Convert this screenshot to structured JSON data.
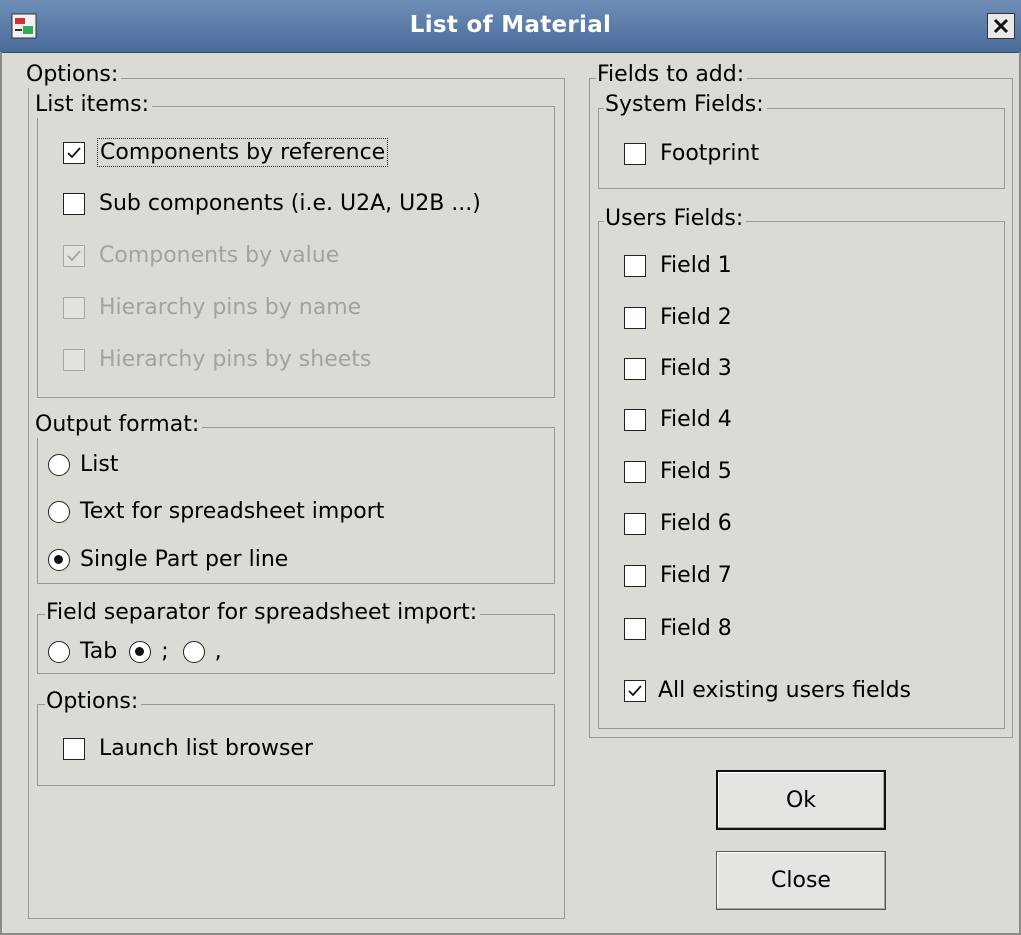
{
  "window": {
    "title": "List of Material"
  },
  "left": {
    "title": "Options:",
    "list_items": {
      "title": "List items:",
      "items": [
        {
          "label": "Components by reference",
          "checked": true,
          "enabled": true
        },
        {
          "label": "Sub components (i.e. U2A, U2B ...)",
          "checked": false,
          "enabled": true
        },
        {
          "label": "Components by value",
          "checked": true,
          "enabled": false
        },
        {
          "label": "Hierarchy pins by name",
          "checked": false,
          "enabled": false
        },
        {
          "label": "Hierarchy pins by sheets",
          "checked": false,
          "enabled": false
        }
      ]
    },
    "output_format": {
      "title": "Output format:",
      "options": [
        "List",
        "Text for spreadsheet import",
        "Single Part per line"
      ],
      "selected": "Single Part per line"
    },
    "separator": {
      "title": "Field separator for spreadsheet import:",
      "options": [
        "Tab",
        ";",
        ","
      ],
      "selected": ";"
    },
    "options": {
      "title": "Options:",
      "launch_label": "Launch list browser",
      "launch_checked": false
    }
  },
  "right": {
    "title": "Fields to add:",
    "system": {
      "title": "System Fields:",
      "footprint_label": "Footprint",
      "footprint_checked": false
    },
    "users": {
      "title": "Users Fields:",
      "fields": [
        "Field 1",
        "Field 2",
        "Field 3",
        "Field 4",
        "Field 5",
        "Field 6",
        "Field 7",
        "Field 8"
      ],
      "all_label": "All existing users fields",
      "all_checked": true
    }
  },
  "buttons": {
    "ok": "Ok",
    "close": "Close"
  }
}
